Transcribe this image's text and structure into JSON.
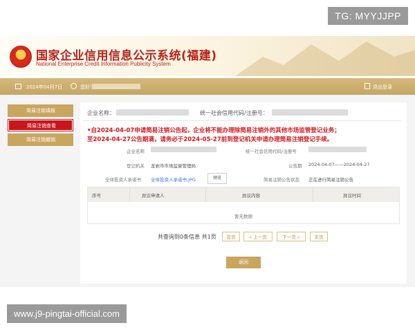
{
  "watermarks": {
    "top": "TG: MYYJJPP",
    "bottom": "www.j9-pingtai-official.com"
  },
  "header": {
    "title_cn": "国家企业信用信息公示系统(福建)",
    "title_en": "National Enterprise Credit Information Publicity System",
    "emblem_icon": "national-emblem-icon",
    "accent_color": "#b8231b"
  },
  "topbar": {
    "date": "2024年04月7日",
    "greeting": "您好！",
    "exit": "退出登录",
    "bg_color": "#c9a865"
  },
  "sidebar": {
    "items": [
      {
        "label": "简易注销填报",
        "active": false
      },
      {
        "label": "简易注销查看",
        "active": true
      },
      {
        "label": "简易注销撤销",
        "active": false
      }
    ]
  },
  "summary": {
    "company_name_label": "企业名称：",
    "credit_code_label": "统一社会信用代码/注册号："
  },
  "notice": {
    "line1": "•自2024-04-07申请简易注销公告起，企业将不能办理除简易注销外的其他市场监管登记业务；",
    "line2": "至2024-04-27公告期满，请务必于2024-05-27前到登记机关申请办理简易注销登记手续。",
    "color": "#d5161b"
  },
  "details": {
    "company_name_label": "企业名称",
    "credit_code_label": "统一社会信用代码/注册号",
    "authority_label": "登记机关",
    "authority_value": "龙岩市市场监督管理局",
    "period_label": "公告期",
    "period_value": "2024-04-07——2024-04-27",
    "commitment_label": "全体投资人承诺书",
    "commitment_link": "全体投资人承诺书.JPG",
    "preview_button": "预览",
    "status_label": "简易注销公告状态",
    "status_value": "正在进行简易注销公告"
  },
  "objection_table": {
    "columns": [
      "序号",
      "异议申请人",
      "异议内容",
      "异议时间"
    ],
    "rows": [],
    "empty_text": "暂无数据"
  },
  "pagination": {
    "info": "共查询到0条信息 共1页",
    "first": "首页",
    "prev": "« 上一页",
    "next": "下一页 »",
    "last": "末页"
  },
  "back_button": "返回"
}
